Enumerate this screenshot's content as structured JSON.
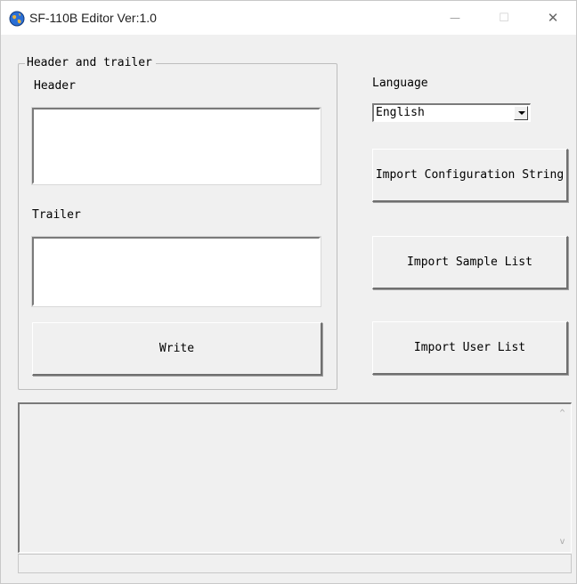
{
  "window": {
    "title": "SF-110B Editor Ver:1.0",
    "minimize_glyph": "—",
    "maximize_glyph": "☐",
    "close_glyph": "✕"
  },
  "group": {
    "legend": "Header and trailer",
    "header_label": "Header",
    "header_value": "",
    "trailer_label": "Trailer",
    "trailer_value": "",
    "write_button": "Write"
  },
  "language": {
    "label": "Language",
    "selected": "English"
  },
  "buttons": {
    "import_config": "Import Configuration String",
    "import_sample": "Import Sample List",
    "import_user": "Import User List"
  },
  "log": {
    "text": "",
    "scroll_up_glyph": "^",
    "scroll_down_glyph": "v"
  },
  "colors": {
    "background": "#f0f0f0",
    "titlebar": "#ffffff",
    "field": "#ffffff"
  }
}
